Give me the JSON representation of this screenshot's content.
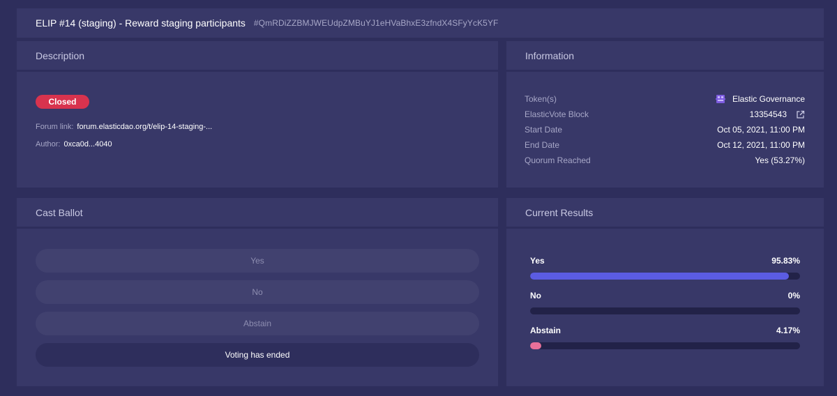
{
  "header": {
    "title": "ELIP #14 (staging) - Reward staging participants",
    "hash": "#QmRDiZZBMJWEUdpZMBuYJ1eHVaBhxE3zfndX4SFyYcK5YF"
  },
  "description": {
    "heading": "Description",
    "status": "Closed",
    "forum_label": "Forum link:",
    "forum_value": "forum.elasticdao.org/t/elip-14-staging-...",
    "author_label": "Author:",
    "author_value": "0xca0d...4040"
  },
  "information": {
    "heading": "Information",
    "rows": [
      {
        "label": "Token(s)",
        "value": "Elastic Governance",
        "icon": "token-icon"
      },
      {
        "label": "ElasticVote Block",
        "value": "13354543",
        "icon": "external-link-icon"
      },
      {
        "label": "Start Date",
        "value": "Oct 05, 2021, 11:00 PM"
      },
      {
        "label": "End Date",
        "value": "Oct 12, 2021, 11:00 PM"
      },
      {
        "label": "Quorum Reached",
        "value": "Yes (53.27%)"
      }
    ]
  },
  "ballot": {
    "heading": "Cast Ballot",
    "options": [
      "Yes",
      "No",
      "Abstain"
    ],
    "status_button": "Voting has ended"
  },
  "results": {
    "heading": "Current Results",
    "items": [
      {
        "label": "Yes",
        "percent_text": "95.83%",
        "fraction": 0.9583,
        "color": "#5b5ce2"
      },
      {
        "label": "No",
        "percent_text": "0%",
        "fraction": 0,
        "color": "#5b5ce2"
      },
      {
        "label": "Abstain",
        "percent_text": "4.17%",
        "fraction": 0.0417,
        "color": "#e8709a"
      }
    ]
  },
  "colors": {
    "background": "#2e2e5c",
    "panel": "#383868",
    "closed_badge": "#d8334e"
  }
}
